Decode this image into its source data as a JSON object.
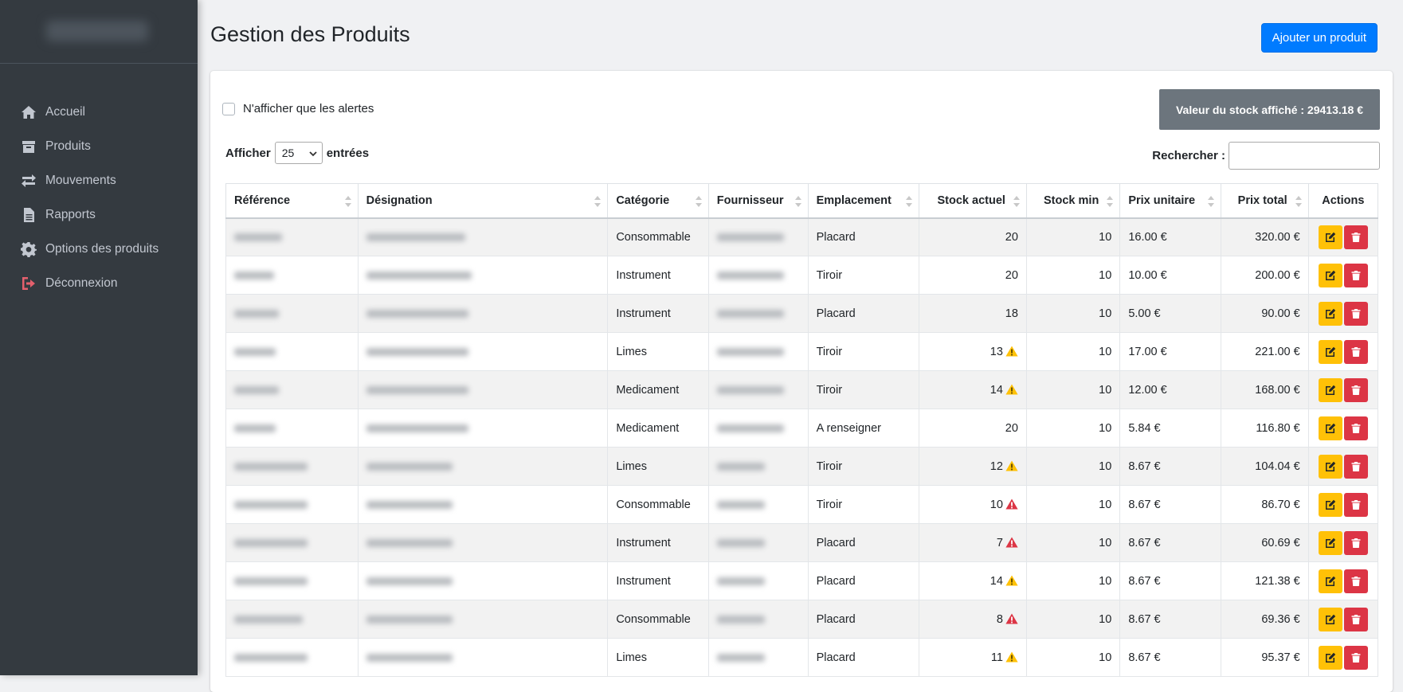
{
  "sidebar": {
    "items": [
      {
        "label": "Accueil",
        "icon": "home-icon"
      },
      {
        "label": "Produits",
        "icon": "box-icon"
      },
      {
        "label": "Mouvements",
        "icon": "exchange-icon"
      },
      {
        "label": "Rapports",
        "icon": "file-icon"
      },
      {
        "label": "Options des produits",
        "icon": "gear-icon"
      },
      {
        "label": "Déconnexion",
        "icon": "sign-out-icon"
      }
    ]
  },
  "header": {
    "title": "Gestion des Produits",
    "add_button": "Ajouter un produit"
  },
  "filters": {
    "alerts_only_label": "N'afficher que les alertes",
    "stock_value_text": "Valeur du stock affiché : 29413.18 €",
    "length_prefix": "Afficher",
    "length_value": "25",
    "length_suffix": "entrées",
    "search_label": "Rechercher :"
  },
  "table": {
    "columns": [
      "Référence",
      "Désignation",
      "Catégorie",
      "Fournisseur",
      "Emplacement",
      "Stock actuel",
      "Stock min",
      "Prix unitaire",
      "Prix total",
      "Actions"
    ],
    "rows": [
      {
        "categorie": "Consommable",
        "emplacement": "Placard",
        "stock": "20",
        "alert": "none",
        "min": "10",
        "prix": "16.00 €",
        "total": "320.00 €"
      },
      {
        "categorie": "Instrument",
        "emplacement": "Tiroir",
        "stock": "20",
        "alert": "none",
        "min": "10",
        "prix": "10.00 €",
        "total": "200.00 €"
      },
      {
        "categorie": "Instrument",
        "emplacement": "Placard",
        "stock": "18",
        "alert": "none",
        "min": "10",
        "prix": "5.00 €",
        "total": "90.00 €"
      },
      {
        "categorie": "Limes",
        "emplacement": "Tiroir",
        "stock": "13",
        "alert": "warning",
        "min": "10",
        "prix": "17.00 €",
        "total": "221.00 €"
      },
      {
        "categorie": "Medicament",
        "emplacement": "Tiroir",
        "stock": "14",
        "alert": "warning",
        "min": "10",
        "prix": "12.00 €",
        "total": "168.00 €"
      },
      {
        "categorie": "Medicament",
        "emplacement": "A renseigner",
        "stock": "20",
        "alert": "none",
        "min": "10",
        "prix": "5.84 €",
        "total": "116.80 €"
      },
      {
        "categorie": "Limes",
        "emplacement": "Tiroir",
        "stock": "12",
        "alert": "warning",
        "min": "10",
        "prix": "8.67 €",
        "total": "104.04 €"
      },
      {
        "categorie": "Consommable",
        "emplacement": "Tiroir",
        "stock": "10",
        "alert": "danger",
        "min": "10",
        "prix": "8.67 €",
        "total": "86.70 €"
      },
      {
        "categorie": "Instrument",
        "emplacement": "Placard",
        "stock": "7",
        "alert": "danger",
        "min": "10",
        "prix": "8.67 €",
        "total": "60.69 €"
      },
      {
        "categorie": "Instrument",
        "emplacement": "Placard",
        "stock": "14",
        "alert": "warning",
        "min": "10",
        "prix": "8.67 €",
        "total": "121.38 €"
      },
      {
        "categorie": "Consommable",
        "emplacement": "Placard",
        "stock": "8",
        "alert": "danger",
        "min": "10",
        "prix": "8.67 €",
        "total": "69.36 €"
      },
      {
        "categorie": "Limes",
        "emplacement": "Placard",
        "stock": "11",
        "alert": "warning",
        "min": "10",
        "prix": "8.67 €",
        "total": "95.37 €"
      }
    ]
  },
  "colors": {
    "sidebar_bg": "#343a40",
    "primary": "#007bff",
    "warning": "#ffc107",
    "danger": "#dc3545",
    "secondary": "#6c757d"
  }
}
